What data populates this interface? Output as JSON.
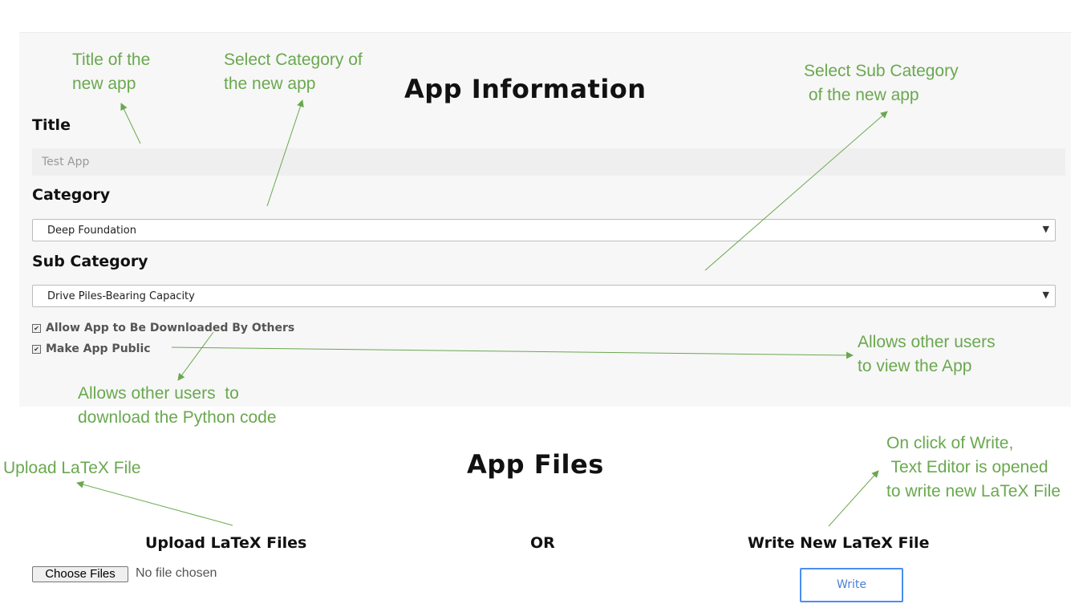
{
  "app_info": {
    "heading": "App Information",
    "title_label": "Title",
    "title_value": "Test App",
    "category_label": "Category",
    "category_value": "Deep Foundation",
    "subcategory_label": "Sub Category",
    "subcategory_value": "Drive Piles-Bearing Capacity",
    "allow_download_label": "Allow App to Be Downloaded By Others",
    "make_public_label": "Make App Public"
  },
  "app_files": {
    "heading": "App Files",
    "upload_heading": "Upload LaTeX Files",
    "or_label": "OR",
    "write_heading": "Write New LaTeX File",
    "choose_files_label": "Choose Files",
    "no_file_text": "No file chosen",
    "write_button_label": "Write"
  },
  "annotations": {
    "title_note": "Title of the\nnew app",
    "category_note": "Select Category of\nthe new app",
    "subcategory_note": "Select Sub Category\n of the new app",
    "download_note": "Allows other users  to\ndownload the Python code",
    "public_note": "Allows other users\nto view the App",
    "upload_note": "Upload LaTeX File",
    "write_note": "On click of Write,\n Text Editor is opened\nto write new LaTeX File"
  },
  "colors": {
    "annotation": "#6aa84f",
    "panel_bg": "#f7f7f7",
    "write_border": "#4a8ef0"
  },
  "icons": [
    "checkbox-checked-icon",
    "dropdown-arrow-icon",
    "annotation-arrow-icon"
  ]
}
